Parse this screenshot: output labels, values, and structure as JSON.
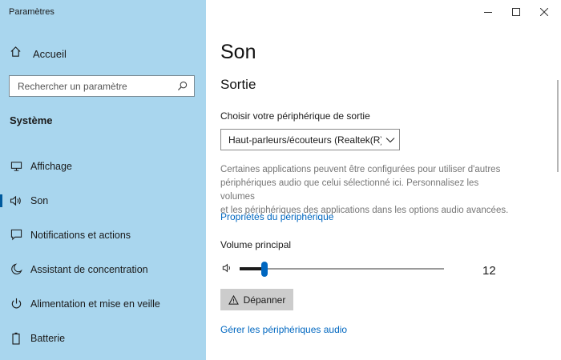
{
  "window": {
    "title": "Paramètres",
    "controls": {
      "minimize": "–",
      "maximize": "☐",
      "close": "✕"
    }
  },
  "sidebar": {
    "home_label": "Accueil",
    "search_placeholder": "Rechercher un paramètre",
    "section_title": "Système",
    "items": [
      {
        "label": "Affichage",
        "icon": "monitor-icon"
      },
      {
        "label": "Son",
        "icon": "speaker-icon",
        "active": true
      },
      {
        "label": "Notifications et actions",
        "icon": "notification-icon"
      },
      {
        "label": "Assistant de concentration",
        "icon": "moon-icon"
      },
      {
        "label": "Alimentation et mise en veille",
        "icon": "power-icon"
      },
      {
        "label": "Batterie",
        "icon": "battery-icon"
      }
    ]
  },
  "main": {
    "page_title": "Son",
    "section_title": "Sortie",
    "output_device_label": "Choisir votre périphérique de sortie",
    "output_device_value": "Haut-parleurs/écouteurs (Realtek(R)...",
    "description_lines": [
      "Certaines applications peuvent être configurées pour utiliser d'autres",
      "périphériques audio que celui sélectionné ici. Personnalisez les volumes",
      "et les périphériques des applications dans les options audio avancées."
    ],
    "device_properties_link": "Propriétés du périphérique",
    "volume_label": "Volume principal",
    "volume_value": "12",
    "volume_level": 12,
    "troubleshoot_label": "Dépanner",
    "manage_devices_link": "Gérer les périphériques audio"
  },
  "colors": {
    "sidebar_bg": "#a9d6ee",
    "accent": "#0067c0",
    "button_bg": "#cccccc"
  }
}
